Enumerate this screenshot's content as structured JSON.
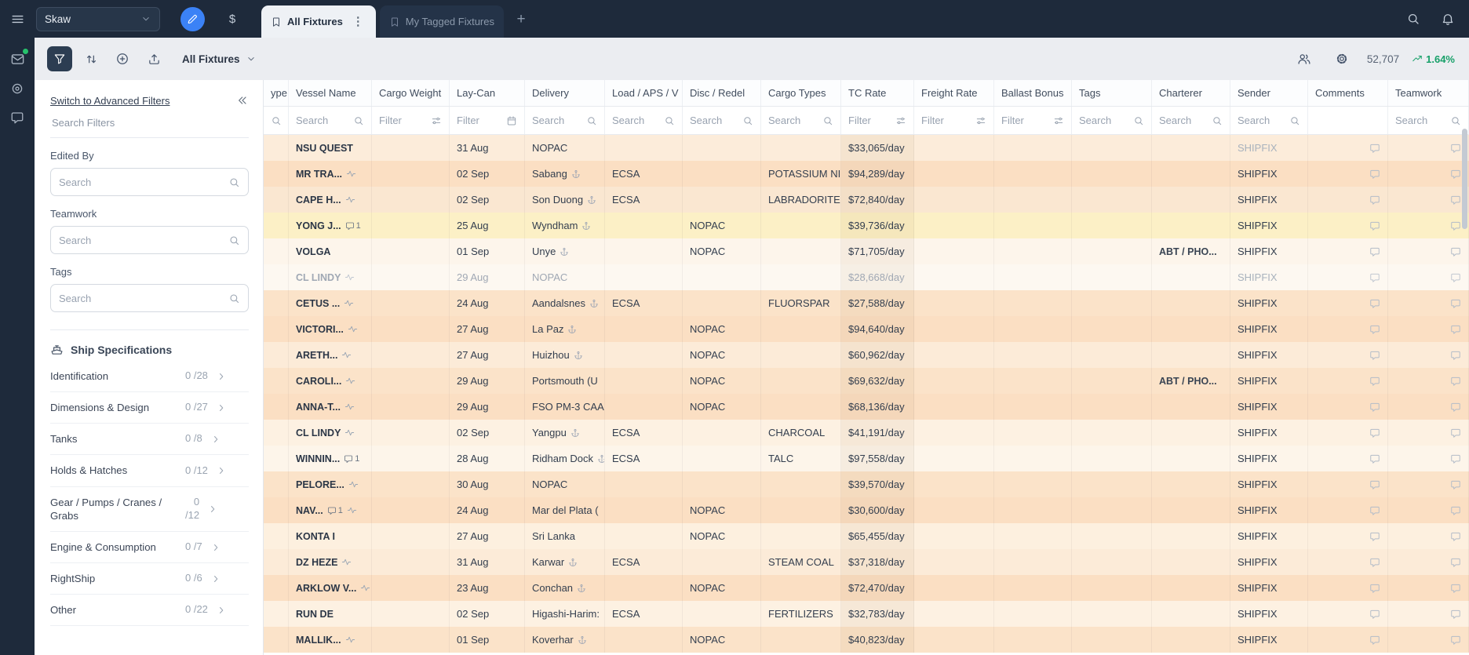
{
  "topbar": {
    "workspace": "Skaw",
    "dollar_label": "$",
    "add_tab_label": "+",
    "tab_menu_glyph": "⋮",
    "tabs": [
      {
        "label": "All Fixtures",
        "active": true
      },
      {
        "label": "My Tagged Fixtures",
        "active": false
      }
    ]
  },
  "toolbar": {
    "view_selector": "All Fixtures",
    "count": "52,707",
    "trend": "1.64%"
  },
  "filter_panel": {
    "advanced_link": "Switch to Advanced Filters",
    "search_placeholder": "Search Filters",
    "groups": [
      {
        "label": "Edited By",
        "placeholder": "Search"
      },
      {
        "label": "Teamwork",
        "placeholder": "Search"
      },
      {
        "label": "Tags",
        "placeholder": "Search"
      }
    ],
    "ship_specs": {
      "title": "Ship Specifications",
      "items": [
        {
          "label": "Identification",
          "count": "0 /28",
          "wrap": false
        },
        {
          "label": "Dimensions & Design",
          "count": "0 /27",
          "wrap": false
        },
        {
          "label": "Tanks",
          "count": "0 /8",
          "wrap": false
        },
        {
          "label": "Holds & Hatches",
          "count": "0 /12",
          "wrap": false
        },
        {
          "label": "Gear / Pumps / Cranes / Grabs",
          "count": "0 /12",
          "wrap": true
        },
        {
          "label": "Engine & Consumption",
          "count": "0 /7",
          "wrap": false
        },
        {
          "label": "RightShip",
          "count": "0 /6",
          "wrap": false
        },
        {
          "label": "Other",
          "count": "0 /22",
          "wrap": false
        }
      ]
    }
  },
  "table": {
    "columns": [
      {
        "label": "ype",
        "filter_placeholder": "",
        "filter_icon": "search"
      },
      {
        "label": "Vessel Name",
        "filter_placeholder": "Search",
        "filter_icon": "search"
      },
      {
        "label": "Cargo Weight",
        "filter_placeholder": "Filter",
        "filter_icon": "sliders"
      },
      {
        "label": "Lay-Can",
        "filter_placeholder": "Filter",
        "filter_icon": "calendar"
      },
      {
        "label": "Delivery",
        "filter_placeholder": "Search",
        "filter_icon": "search"
      },
      {
        "label": "Load / APS / V",
        "filter_placeholder": "Search",
        "filter_icon": "search"
      },
      {
        "label": "Disc / Redel",
        "filter_placeholder": "Search",
        "filter_icon": "search"
      },
      {
        "label": "Cargo Types",
        "filter_placeholder": "Search",
        "filter_icon": "search"
      },
      {
        "label": "TC Rate",
        "filter_placeholder": "Filter",
        "filter_icon": "sliders"
      },
      {
        "label": "Freight Rate",
        "filter_placeholder": "Filter",
        "filter_icon": "sliders"
      },
      {
        "label": "Ballast Bonus",
        "filter_placeholder": "Filter",
        "filter_icon": "sliders"
      },
      {
        "label": "Tags",
        "filter_placeholder": "Search",
        "filter_icon": "search"
      },
      {
        "label": "Charterer",
        "filter_placeholder": "Search",
        "filter_icon": "search"
      },
      {
        "label": "Sender",
        "filter_placeholder": "Search",
        "filter_icon": "search"
      },
      {
        "label": "Comments",
        "filter_placeholder": "",
        "filter_icon": ""
      },
      {
        "label": "Teamwork",
        "filter_placeholder": "Search",
        "filter_icon": "search"
      }
    ],
    "rows": [
      {
        "bg": "#fcecda",
        "vessel": "NSU QUEST",
        "icons": [],
        "laycan": "31 Aug",
        "delivery": "NOPAC",
        "anchor": false,
        "load": "",
        "disc": "",
        "cargo": "",
        "tc": "$33,065/day",
        "charterer": "",
        "sender": "SHIPFIX",
        "sender_muted": true,
        "muted": false
      },
      {
        "bg": "#fbdfc3",
        "vessel": "MR TRA...",
        "icons": [
          "pulse"
        ],
        "laycan": "02 Sep",
        "delivery": "Sabang",
        "anchor": true,
        "load": "ECSA",
        "disc": "",
        "cargo": "POTASSIUM NI",
        "tc": "$94,289/day",
        "charterer": "",
        "sender": "SHIPFIX",
        "sender_muted": false,
        "muted": false
      },
      {
        "bg": "#fae7d1",
        "vessel": "CAPE H...",
        "icons": [
          "pulse"
        ],
        "laycan": "02 Sep",
        "delivery": "Son Duong",
        "anchor": true,
        "load": "ECSA",
        "disc": "",
        "cargo": "LABRADORITE",
        "tc": "$72,840/day",
        "charterer": "",
        "sender": "SHIPFIX",
        "sender_muted": false,
        "muted": false
      },
      {
        "bg": "#fcf0c6",
        "vessel": "YONG J...",
        "icons": [
          "comment"
        ],
        "comment_count": "1",
        "laycan": "25 Aug",
        "delivery": "Wyndham",
        "anchor": true,
        "load": "",
        "disc": "NOPAC",
        "cargo": "",
        "tc": "$39,736/day",
        "charterer": "",
        "sender": "SHIPFIX",
        "sender_muted": false,
        "muted": false
      },
      {
        "bg": "#fdf5eb",
        "vessel": "VOLGA",
        "icons": [],
        "laycan": "01 Sep",
        "delivery": "Unye",
        "anchor": true,
        "load": "",
        "disc": "NOPAC",
        "cargo": "",
        "tc": "$71,705/day",
        "charterer": "ABT / PHO...",
        "sender": "SHIPFIX",
        "sender_muted": false,
        "muted": false
      },
      {
        "bg": "#fdf8f1",
        "vessel": "CL LINDY",
        "icons": [
          "pulse"
        ],
        "laycan": "29 Aug",
        "delivery": "NOPAC",
        "anchor": false,
        "load": "",
        "disc": "",
        "cargo": "",
        "tc": "$28,668/day",
        "charterer": "",
        "sender": "SHIPFIX",
        "sender_muted": true,
        "muted": true
      },
      {
        "bg": "#fbe3c9",
        "vessel": "CETUS ...",
        "icons": [
          "pulse"
        ],
        "laycan": "24 Aug",
        "delivery": "Aandalsnes",
        "anchor": true,
        "load": "ECSA",
        "disc": "",
        "cargo": "FLUORSPAR",
        "tc": "$27,588/day",
        "charterer": "",
        "sender": "SHIPFIX",
        "sender_muted": false,
        "muted": false
      },
      {
        "bg": "#fbdfc3",
        "vessel": "VICTORI...",
        "icons": [
          "pulse"
        ],
        "laycan": "27 Aug",
        "delivery": "La Paz",
        "anchor": true,
        "load": "",
        "disc": "NOPAC",
        "cargo": "",
        "tc": "$94,640/day",
        "charterer": "",
        "sender": "SHIPFIX",
        "sender_muted": false,
        "muted": false
      },
      {
        "bg": "#fcebd8",
        "vessel": "ARETH...",
        "icons": [
          "pulse"
        ],
        "laycan": "27 Aug",
        "delivery": "Huizhou",
        "anchor": true,
        "load": "",
        "disc": "NOPAC",
        "cargo": "",
        "tc": "$60,962/day",
        "charterer": "",
        "sender": "SHIPFIX",
        "sender_muted": false,
        "muted": false
      },
      {
        "bg": "#fbe3c9",
        "vessel": "CAROLI...",
        "icons": [
          "pulse"
        ],
        "laycan": "29 Aug",
        "delivery": "Portsmouth (U",
        "anchor": false,
        "load": "",
        "disc": "NOPAC",
        "cargo": "",
        "tc": "$69,632/day",
        "charterer": "ABT / PHO...",
        "sender": "SHIPFIX",
        "sender_muted": false,
        "muted": false
      },
      {
        "bg": "#fbdfc3",
        "vessel": "ANNA-T...",
        "icons": [
          "pulse"
        ],
        "laycan": "29 Aug",
        "delivery": "FSO PM-3 CAA",
        "anchor": false,
        "load": "",
        "disc": "NOPAC",
        "cargo": "",
        "tc": "$68,136/day",
        "charterer": "",
        "sender": "SHIPFIX",
        "sender_muted": false,
        "muted": false
      },
      {
        "bg": "#fdf1e2",
        "vessel": "CL LINDY",
        "icons": [
          "pulse"
        ],
        "laycan": "02 Sep",
        "delivery": "Yangpu",
        "anchor": true,
        "load": "ECSA",
        "disc": "",
        "cargo": "CHARCOAL",
        "tc": "$41,191/day",
        "charterer": "",
        "sender": "SHIPFIX",
        "sender_muted": false,
        "muted": false
      },
      {
        "bg": "#fdf5ea",
        "vessel": "WINNIN...",
        "icons": [
          "comment"
        ],
        "comment_count": "1",
        "laycan": "28 Aug",
        "delivery": "Ridham Dock",
        "anchor": true,
        "load": "ECSA",
        "disc": "",
        "cargo": "TALC",
        "tc": "$97,558/day",
        "charterer": "",
        "sender": "SHIPFIX",
        "sender_muted": false,
        "muted": false
      },
      {
        "bg": "#fbe3c9",
        "vessel": "PELORE...",
        "icons": [
          "pulse"
        ],
        "laycan": "30 Aug",
        "delivery": "NOPAC",
        "anchor": false,
        "load": "",
        "disc": "",
        "cargo": "",
        "tc": "$39,570/day",
        "charterer": "",
        "sender": "SHIPFIX",
        "sender_muted": false,
        "muted": false
      },
      {
        "bg": "#fbdfc3",
        "vessel": "NAV...",
        "icons": [
          "comment",
          "pulse"
        ],
        "comment_count": "1",
        "laycan": "24 Aug",
        "delivery": "Mar del Plata (",
        "anchor": false,
        "load": "",
        "disc": "NOPAC",
        "cargo": "",
        "tc": "$30,600/day",
        "charterer": "",
        "sender": "SHIPFIX",
        "sender_muted": false,
        "muted": false
      },
      {
        "bg": "#fdf0df",
        "vessel": "KONTA I",
        "icons": [],
        "laycan": "27 Aug",
        "delivery": "Sri Lanka",
        "anchor": false,
        "load": "",
        "disc": "NOPAC",
        "cargo": "",
        "tc": "$65,455/day",
        "charterer": "",
        "sender": "SHIPFIX",
        "sender_muted": false,
        "muted": false
      },
      {
        "bg": "#fcebd8",
        "vessel": "DZ HEZE",
        "icons": [
          "pulse"
        ],
        "laycan": "31 Aug",
        "delivery": "Karwar",
        "anchor": true,
        "load": "ECSA",
        "disc": "",
        "cargo": "STEAM COAL",
        "tc": "$37,318/day",
        "charterer": "",
        "sender": "SHIPFIX",
        "sender_muted": false,
        "muted": false
      },
      {
        "bg": "#fbdfc3",
        "vessel": "ARKLOW V...",
        "icons": [
          "pulse"
        ],
        "laycan": "23 Aug",
        "delivery": "Conchan",
        "anchor": true,
        "load": "",
        "disc": "NOPAC",
        "cargo": "",
        "tc": "$72,470/day",
        "charterer": "",
        "sender": "SHIPFIX",
        "sender_muted": false,
        "muted": false
      },
      {
        "bg": "#fdf1e2",
        "vessel": "RUN DE",
        "icons": [],
        "laycan": "02 Sep",
        "delivery": "Higashi-Harim:",
        "anchor": false,
        "load": "ECSA",
        "disc": "",
        "cargo": "FERTILIZERS",
        "tc": "$32,783/day",
        "charterer": "",
        "sender": "SHIPFIX",
        "sender_muted": false,
        "muted": false
      },
      {
        "bg": "#fbe3c9",
        "vessel": "MALLIK...",
        "icons": [
          "pulse"
        ],
        "laycan": "01 Sep",
        "delivery": "Koverhar",
        "anchor": true,
        "load": "",
        "disc": "NOPAC",
        "cargo": "",
        "tc": "$40,823/day",
        "charterer": "",
        "sender": "SHIPFIX",
        "sender_muted": false,
        "muted": false
      }
    ]
  },
  "colors": {
    "topbar": "#1e2a3b",
    "accent_blue": "#3b82f6",
    "green": "#17a069",
    "highlight_row": "#fcf0c6"
  }
}
